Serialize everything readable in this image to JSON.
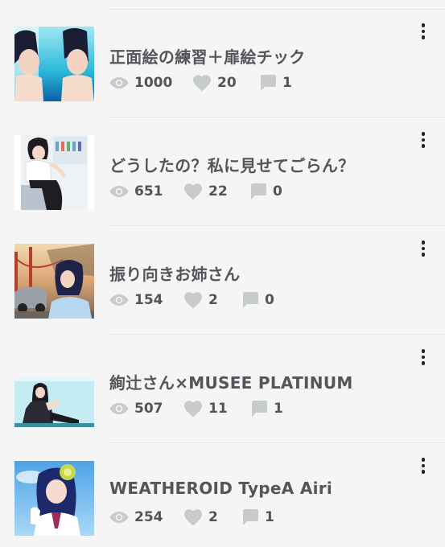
{
  "items": [
    {
      "title": "正面絵の練習＋扉絵チック",
      "views": "1000",
      "likes": "20",
      "comments": "1",
      "thumbnail": "artwork-two-figures-blue-background"
    },
    {
      "title": "どうしたの？私に見せてごらん？",
      "views": "651",
      "likes": "22",
      "comments": "0",
      "thumbnail": "artwork-woman-in-office"
    },
    {
      "title": "振り向きお姉さん",
      "views": "154",
      "likes": "2",
      "comments": "0",
      "thumbnail": "artwork-woman-bridge-background"
    },
    {
      "title": "絢辻さん×MUSEE PLATINUM",
      "views": "507",
      "likes": "11",
      "comments": "1",
      "thumbnail": "artwork-seated-girl-reading"
    },
    {
      "title": "WEATHEROID TypeA Airi",
      "views": "254",
      "likes": "2",
      "comments": "1",
      "thumbnail": "artwork-girl-with-flower-sky"
    }
  ],
  "colors": {
    "background": "#f5f5f5",
    "title_text": "#55545a",
    "stat_text": "#545454",
    "stat_icon": "#c7cbcb",
    "divider": "#e6e6e6",
    "menu_dots": "#222222"
  },
  "icons": {
    "views": "eye-icon",
    "likes": "heart-icon",
    "comments": "comment-bubble-icon",
    "menu": "more-vertical-icon"
  }
}
